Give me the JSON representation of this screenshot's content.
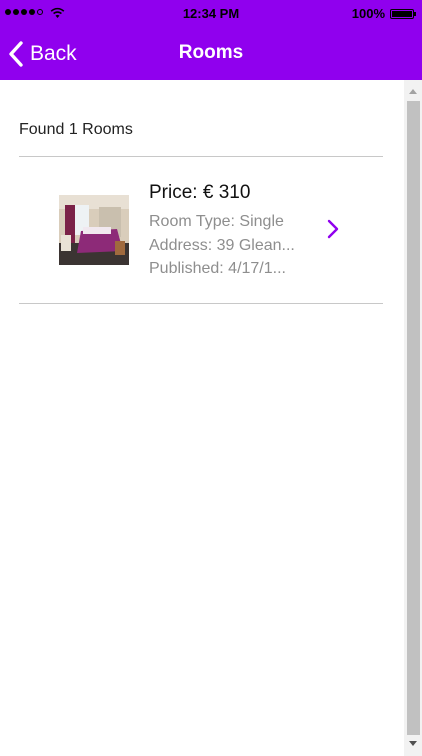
{
  "status_bar": {
    "time": "12:34 PM",
    "battery": "100%"
  },
  "nav": {
    "back_label": "Back",
    "title": "Rooms"
  },
  "results": {
    "found_text": "Found 1 Rooms"
  },
  "rooms": [
    {
      "price": "Price: € 310",
      "room_type": "Room Type: Single",
      "address": "Address: 39 Glean...",
      "published": "Published: 4/17/1..."
    }
  ],
  "colors": {
    "accent": "#9000ee",
    "muted_text": "#8e8e8e"
  }
}
